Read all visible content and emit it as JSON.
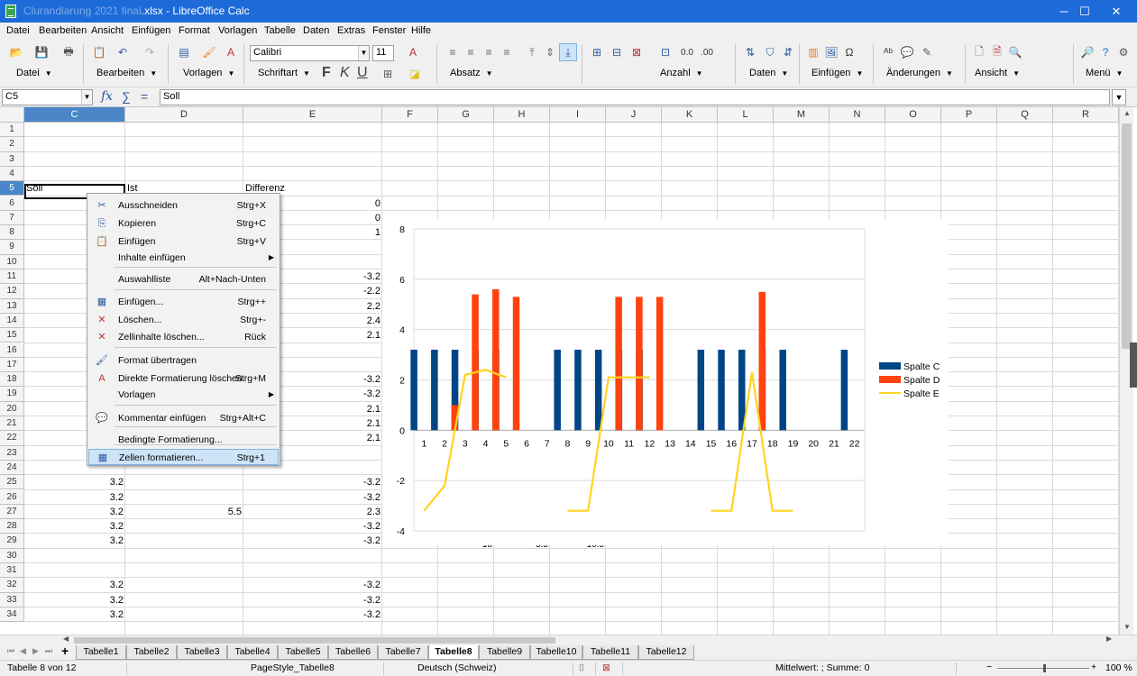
{
  "window": {
    "title_prefix": "Clurandlarung 2021 final",
    "title_suffix": ".xlsx - LibreOffice Calc",
    "minimize": "─",
    "maximize": "☐",
    "close": "✕"
  },
  "menubar": [
    "Datei",
    "Bearbeiten",
    "Ansicht",
    "Einfügen",
    "Format",
    "Vorlagen",
    "Tabelle",
    "Daten",
    "Extras",
    "Fenster",
    "Hilfe"
  ],
  "toolbar": {
    "groups": [
      "Datei",
      "Bearbeiten",
      "Vorlagen",
      "Schriftart",
      "Absatz",
      "Anzahl",
      "Daten",
      "Einfügen",
      "Änderungen",
      "Ansicht",
      "Menü"
    ],
    "font_name": "Calibri",
    "font_size": "11",
    "format_letters": [
      "F",
      "K",
      "U"
    ]
  },
  "formulabar": {
    "cell_ref": "C5",
    "fx": "fx",
    "sum": "∑",
    "equals": "=",
    "content": "Soll"
  },
  "grid": {
    "columns": [
      "C",
      "D",
      "E",
      "F",
      "G",
      "H",
      "I",
      "J",
      "K",
      "L",
      "M",
      "N",
      "O",
      "P",
      "Q",
      "R"
    ],
    "rows": [
      "1",
      "2",
      "3",
      "4",
      "5",
      "6",
      "7",
      "8",
      "9",
      "10",
      "11",
      "12",
      "13",
      "14",
      "15",
      "16",
      "17",
      "18",
      "19",
      "20",
      "21",
      "22",
      "23",
      "24",
      "25",
      "26",
      "27",
      "28",
      "29",
      "30",
      "31",
      "32",
      "33",
      "34"
    ],
    "cells": [
      {
        "row": 5,
        "col": "C",
        "v": "Soll",
        "a": "l"
      },
      {
        "row": 5,
        "col": "D",
        "v": "Ist",
        "a": "l"
      },
      {
        "row": 5,
        "col": "E",
        "v": "Differenz",
        "a": "l"
      },
      {
        "row": 6,
        "col": "E",
        "v": "0",
        "a": "r"
      },
      {
        "row": 7,
        "col": "E",
        "v": "0",
        "a": "r"
      },
      {
        "row": 8,
        "col": "E",
        "v": "1",
        "a": "r"
      },
      {
        "row": 11,
        "col": "E",
        "v": "-3.2",
        "a": "r"
      },
      {
        "row": 12,
        "col": "E",
        "v": "-2.2",
        "a": "r"
      },
      {
        "row": 13,
        "col": "E",
        "v": "2.2",
        "a": "r"
      },
      {
        "row": 14,
        "col": "E",
        "v": "2.4",
        "a": "r"
      },
      {
        "row": 15,
        "col": "E",
        "v": "2.1",
        "a": "r"
      },
      {
        "row": 18,
        "col": "E",
        "v": "-3.2",
        "a": "r"
      },
      {
        "row": 19,
        "col": "E",
        "v": "-3.2",
        "a": "r"
      },
      {
        "row": 20,
        "col": "E",
        "v": "2.1",
        "a": "r"
      },
      {
        "row": 21,
        "col": "E",
        "v": "2.1",
        "a": "r"
      },
      {
        "row": 22,
        "col": "E",
        "v": "2.1",
        "a": "r"
      },
      {
        "row": 25,
        "col": "C",
        "v": "3.2",
        "a": "r"
      },
      {
        "row": 25,
        "col": "E",
        "v": "-3.2",
        "a": "r"
      },
      {
        "row": 26,
        "col": "C",
        "v": "3.2",
        "a": "r"
      },
      {
        "row": 26,
        "col": "E",
        "v": "-3.2",
        "a": "r"
      },
      {
        "row": 27,
        "col": "C",
        "v": "3.2",
        "a": "r"
      },
      {
        "row": 27,
        "col": "D",
        "v": "5.5",
        "a": "r"
      },
      {
        "row": 27,
        "col": "E",
        "v": "2.3",
        "a": "r"
      },
      {
        "row": 28,
        "col": "C",
        "v": "3.2",
        "a": "r"
      },
      {
        "row": 28,
        "col": "E",
        "v": "-3.2",
        "a": "r"
      },
      {
        "row": 29,
        "col": "C",
        "v": "3.2",
        "a": "r"
      },
      {
        "row": 29,
        "col": "E",
        "v": "-3.2",
        "a": "r"
      },
      {
        "row": 32,
        "col": "C",
        "v": "3.2",
        "a": "r"
      },
      {
        "row": 32,
        "col": "E",
        "v": "-3.2",
        "a": "r"
      },
      {
        "row": 33,
        "col": "C",
        "v": "3.2",
        "a": "r"
      },
      {
        "row": 33,
        "col": "E",
        "v": "-3.2",
        "a": "r"
      },
      {
        "row": 34,
        "col": "C",
        "v": "3.2",
        "a": "r"
      },
      {
        "row": 34,
        "col": "E",
        "v": "-3.2",
        "a": "r"
      }
    ],
    "peek_texts": [
      "F",
      "F",
      "18",
      "5.5",
      "-10.5"
    ]
  },
  "context_menu": {
    "items": [
      {
        "icon": "✂",
        "name": "cut",
        "label": "Ausschneiden",
        "shortcut": "Strg+X"
      },
      {
        "icon": "⎘",
        "name": "copy",
        "label": "Kopieren",
        "shortcut": "Strg+C"
      },
      {
        "icon": "📋",
        "name": "paste",
        "label": "Einfügen",
        "shortcut": "Strg+V"
      },
      {
        "icon": "",
        "name": "paste-special",
        "label": "Inhalte einfügen",
        "shortcut": "",
        "sub": true
      },
      {
        "icon": "",
        "name": "selection-list",
        "label": "Auswahlliste",
        "shortcut": "Alt+Nach-Unten"
      },
      {
        "icon": "▦",
        "name": "insert-cells",
        "label": "Einfügen...",
        "shortcut": "Strg++"
      },
      {
        "icon": "✕",
        "name": "delete-cells",
        "label": "Löschen...",
        "shortcut": "Strg+-"
      },
      {
        "icon": "✕",
        "name": "clear-contents",
        "label": "Zellinhalte löschen...",
        "shortcut": "Rück"
      },
      {
        "icon": "🖌",
        "name": "clone-format",
        "label": "Format übertragen",
        "shortcut": ""
      },
      {
        "icon": "A",
        "name": "clear-direct-formatting",
        "label": "Direkte Formatierung löschen",
        "shortcut": "Strg+M"
      },
      {
        "icon": "",
        "name": "styles",
        "label": "Vorlagen",
        "shortcut": "",
        "sub": true
      },
      {
        "icon": "💬",
        "name": "insert-comment",
        "label": "Kommentar einfügen",
        "shortcut": "Strg+Alt+C"
      },
      {
        "icon": "",
        "name": "conditional-formatting",
        "label": "Bedingte Formatierung...",
        "shortcut": ""
      },
      {
        "icon": "▦",
        "name": "format-cells",
        "label": "Zellen formatieren...",
        "shortcut": "Strg+1",
        "highlighted": true
      }
    ]
  },
  "chart_data": {
    "type": "bar",
    "categories": [
      "1",
      "2",
      "3",
      "4",
      "5",
      "6",
      "7",
      "8",
      "9",
      "10",
      "11",
      "12",
      "13",
      "14",
      "15",
      "16",
      "17",
      "18",
      "19",
      "20",
      "21",
      "22"
    ],
    "series": [
      {
        "name": "Spalte C",
        "type": "bar",
        "color": "#004586",
        "values": [
          3.2,
          3.2,
          3.2,
          3.2,
          3.2,
          null,
          null,
          3.2,
          3.2,
          3.2,
          3.2,
          3.2,
          null,
          null,
          3.2,
          3.2,
          3.2,
          3.2,
          3.2,
          null,
          null,
          3.2
        ]
      },
      {
        "name": "Spalte D",
        "type": "bar",
        "color": "#ff420e",
        "values": [
          null,
          1,
          5.4,
          5.6,
          5.3,
          null,
          null,
          null,
          null,
          5.3,
          5.3,
          5.3,
          null,
          null,
          null,
          null,
          5.5,
          null,
          null,
          null,
          null,
          null
        ]
      },
      {
        "name": "Spalte E",
        "type": "line",
        "color": "#ffd320",
        "values": [
          -3.2,
          -2.2,
          2.2,
          2.4,
          2.1,
          null,
          null,
          -3.2,
          -3.2,
          2.1,
          2.1,
          2.1,
          null,
          null,
          -3.2,
          -3.2,
          2.3,
          -3.2,
          -3.2,
          null,
          null,
          null
        ]
      }
    ],
    "ylim": [
      -4,
      8
    ],
    "yticks": [
      "8",
      "6",
      "4",
      "2",
      "0",
      "-2",
      "-4"
    ],
    "grid": true,
    "legend": "right"
  },
  "sheets": {
    "tabs": [
      "Tabelle1",
      "Tabelle2",
      "Tabelle3",
      "Tabelle4",
      "Tabelle5",
      "Tabelle6",
      "Tabelle7",
      "Tabelle8",
      "Tabelle9",
      "Tabelle10",
      "Tabelle11",
      "Tabelle12"
    ],
    "active": "Tabelle8",
    "add": "+"
  },
  "statusbar": {
    "sheet_pos": "Tabelle 8 von 12",
    "page_style": "PageStyle_Tabelle8",
    "language": "Deutsch (Schweiz)",
    "summary": "Mittelwert: ; Summe: 0",
    "zoom": "100 %"
  },
  "colors": {
    "titlebar": "#1c6bd9",
    "selection": "#4a86c8",
    "series_c": "#004586",
    "series_d": "#ff420e",
    "series_e": "#ffd320"
  }
}
